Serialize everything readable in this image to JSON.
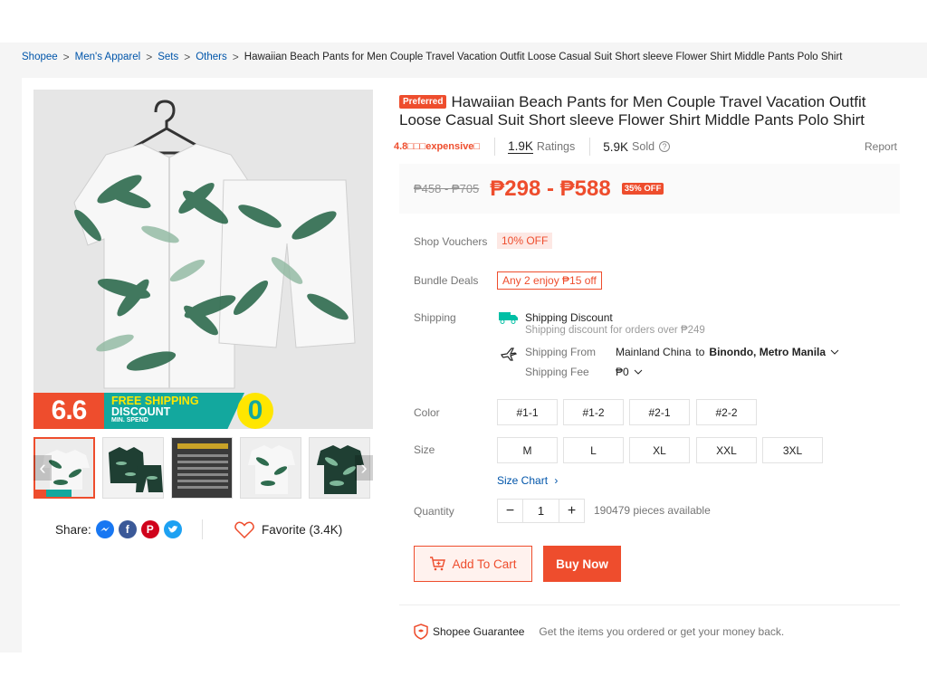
{
  "breadcrumb": {
    "items": [
      "Shopee",
      "Men's Apparel",
      "Sets",
      "Others"
    ],
    "separator": ">",
    "current": "Hawaiian Beach Pants for Men Couple Travel Vacation Outfit Loose Casual Suit Short sleeve Flower Shirt Middle Pants Polo Shirt"
  },
  "gallery": {
    "promo": {
      "event": "6.6",
      "line1": "FREE SHIPPING",
      "line2": "DISCOUNT",
      "line3": "MIN. SPEND",
      "amount": "0"
    },
    "thumbnail_count": 5,
    "active_thumbnail": 0,
    "prev_arrow": "‹",
    "next_arrow": "›"
  },
  "share": {
    "label": "Share:",
    "favorite_label": "Favorite (3.4K)"
  },
  "product": {
    "badge": "Preferred",
    "title": "Hawaiian Beach Pants for Men Couple Travel Vacation Outfit Loose Casual Suit Short sleeve Flower Shirt Middle Pants Polo Shirt",
    "rating_text": "4.8□□□expensive□",
    "ratings_count": "1.9K",
    "ratings_label": "Ratings",
    "sold_count": "5.9K",
    "sold_label": "Sold",
    "report_label": "Report"
  },
  "price": {
    "original": "₱458 - ₱705",
    "current": "₱298 - ₱588",
    "discount": "35% OFF"
  },
  "vouchers": {
    "label": "Shop Vouchers",
    "value": "10% OFF"
  },
  "bundle": {
    "label": "Bundle Deals",
    "value": "Any 2 enjoy ₱15 off"
  },
  "shipping": {
    "label": "Shipping",
    "discount_title": "Shipping Discount",
    "discount_note": "Shipping discount for orders over ₱249",
    "from_label": "Shipping From",
    "from_value": "Mainland China",
    "to_word": "to",
    "to_value": "Binondo, Metro Manila",
    "fee_label": "Shipping Fee",
    "fee_value": "₱0"
  },
  "color": {
    "label": "Color",
    "options": [
      "#1-1",
      "#1-2",
      "#2-1",
      "#2-2"
    ]
  },
  "size": {
    "label": "Size",
    "options": [
      "M",
      "L",
      "XL",
      "XXL",
      "3XL"
    ],
    "chart_link": "Size Chart"
  },
  "quantity": {
    "label": "Quantity",
    "value": "1",
    "minus": "−",
    "plus": "+",
    "available": "190479 pieces available"
  },
  "actions": {
    "add_to_cart": "Add To Cart",
    "buy_now": "Buy Now"
  },
  "guarantee": {
    "title": "Shopee Guarantee",
    "text": "Get the items you ordered or get your money back."
  },
  "colors": {
    "accent": "#ee4d2d",
    "link": "#0055aa",
    "promo_teal": "#13a89e",
    "promo_yellow": "#ffe600"
  }
}
